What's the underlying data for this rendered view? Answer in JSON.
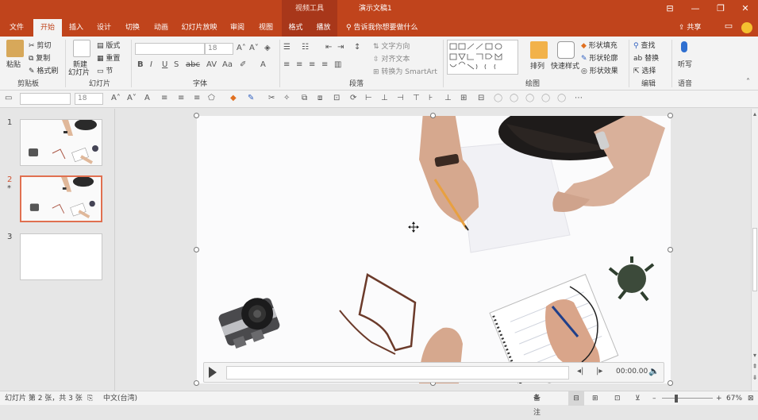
{
  "titlebar": {
    "context_tool": "视频工具",
    "document_title": "演示文稿1",
    "buttons": {
      "restore_ribbon": "⊟",
      "minimize": "—",
      "maximize": "❐",
      "close": "✕"
    }
  },
  "tabs": [
    {
      "label": "文件"
    },
    {
      "label": "开始"
    },
    {
      "label": "插入"
    },
    {
      "label": "设计"
    },
    {
      "label": "切换"
    },
    {
      "label": "动画"
    },
    {
      "label": "幻灯片放映"
    },
    {
      "label": "审阅"
    },
    {
      "label": "视图"
    },
    {
      "label": "格式"
    },
    {
      "label": "播放"
    }
  ],
  "tellme": "告诉我你想要做什么",
  "share": "共享",
  "ribbon": {
    "clipboard": {
      "paste": "粘贴",
      "cut": "剪切",
      "copy": "复制",
      "format_painter": "格式刷",
      "group": "剪贴板"
    },
    "slides": {
      "new_slide": "新建",
      "new_slide_2": "幻灯片",
      "layout": "版式",
      "reset": "重置",
      "section": "节",
      "group": "幻灯片"
    },
    "font": {
      "size": "18",
      "group": "字体"
    },
    "paragraph": {
      "text_direction": "文字方向",
      "align_text": "对齐文本",
      "smartart": "转换为 SmartArt",
      "group": "段落"
    },
    "drawing": {
      "arrange": "排列",
      "quick_styles": "快速样式",
      "shape_fill": "形状填充",
      "shape_outline": "形状轮廓",
      "shape_effects": "形状效果",
      "group": "绘图"
    },
    "editing": {
      "find": "查找",
      "replace": "替换",
      "select": "选择",
      "group": "编辑"
    },
    "voice": {
      "dictate": "听写",
      "group": "语音"
    }
  },
  "toolbar2": {
    "font_size": "18"
  },
  "thumbnails": [
    {
      "num": "1"
    },
    {
      "num": "2",
      "star": "*"
    },
    {
      "num": "3"
    }
  ],
  "media": {
    "time": "00:00.00"
  },
  "status": {
    "slide_info": "幻灯片 第 2 张，共 3 张",
    "language": "中文(台湾)",
    "notes": "备注",
    "zoom": "67%"
  },
  "colors": {
    "accent": "#c0441c",
    "context": "#a8371a",
    "selection": "#e07050"
  }
}
